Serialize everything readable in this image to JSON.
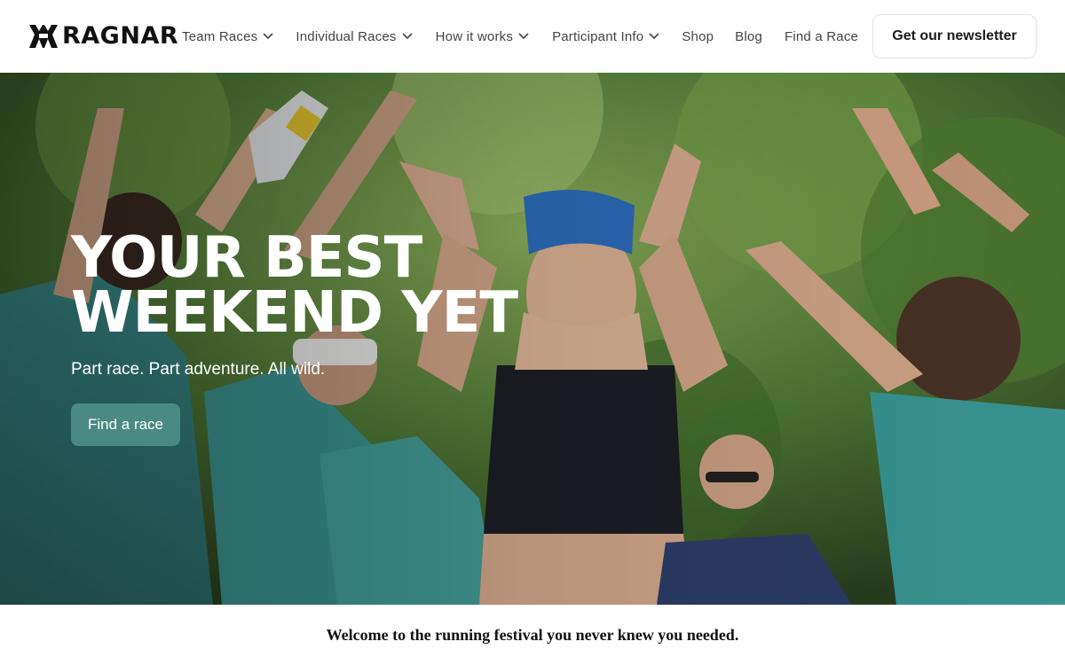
{
  "brand": {
    "name": "RAGNAR",
    "logo_icon": "ragnar-mark-icon"
  },
  "nav": {
    "items": [
      {
        "label": "Team Races",
        "has_dropdown": true
      },
      {
        "label": "Individual Races",
        "has_dropdown": true
      },
      {
        "label": "How it works",
        "has_dropdown": true
      },
      {
        "label": "Participant Info",
        "has_dropdown": true
      },
      {
        "label": "Shop",
        "has_dropdown": false
      },
      {
        "label": "Blog",
        "has_dropdown": false
      },
      {
        "label": "Find a Race",
        "has_dropdown": false
      }
    ],
    "newsletter_label": "Get our newsletter"
  },
  "hero": {
    "title_line1": "YOUR BEST",
    "title_line2": "WEEKEND YET",
    "subtitle": "Part race. Part adventure. All wild.",
    "cta_label": "Find a race",
    "cta_color": "#4a8a83"
  },
  "welcome": "Welcome to the running festival you never knew you needed."
}
